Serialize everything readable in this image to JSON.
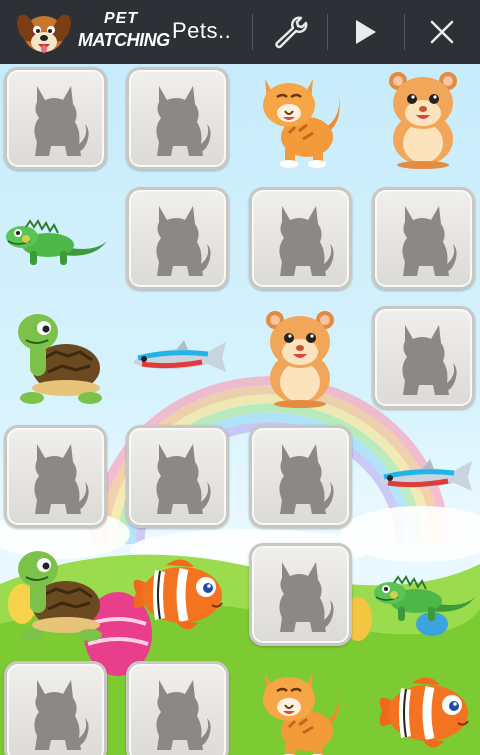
{
  "app": {
    "logo_line1": "PET",
    "logo_line2": "MATCHING",
    "title": "Pets.."
  },
  "toolbar": {
    "settings_icon": "wrench-icon",
    "play_icon": "play-icon",
    "close_icon": "close-icon"
  },
  "colors": {
    "action_bar": "#2d3136",
    "sky": "#d7f3fd",
    "grass": "#8cd23a",
    "card": "#e8e6e2",
    "card_silhouette": "#8a8886"
  },
  "board": {
    "columns": 4,
    "rows": 6,
    "cells": [
      {
        "state": "hidden"
      },
      {
        "state": "hidden"
      },
      {
        "state": "revealed",
        "pet": "cat"
      },
      {
        "state": "revealed",
        "pet": "hamster"
      },
      {
        "state": "revealed",
        "pet": "iguana"
      },
      {
        "state": "hidden"
      },
      {
        "state": "hidden"
      },
      {
        "state": "hidden"
      },
      {
        "state": "revealed",
        "pet": "turtle"
      },
      {
        "state": "revealed",
        "pet": "neon-fish"
      },
      {
        "state": "revealed",
        "pet": "hamster"
      },
      {
        "state": "hidden"
      },
      {
        "state": "hidden"
      },
      {
        "state": "hidden"
      },
      {
        "state": "hidden"
      },
      {
        "state": "revealed",
        "pet": "neon-fish"
      },
      {
        "state": "revealed",
        "pet": "turtle"
      },
      {
        "state": "revealed",
        "pet": "clownfish"
      },
      {
        "state": "hidden"
      },
      {
        "state": "revealed",
        "pet": "iguana"
      },
      {
        "state": "hidden"
      },
      {
        "state": "hidden"
      },
      {
        "state": "revealed",
        "pet": "cat"
      },
      {
        "state": "revealed",
        "pet": "clownfish"
      }
    ]
  }
}
